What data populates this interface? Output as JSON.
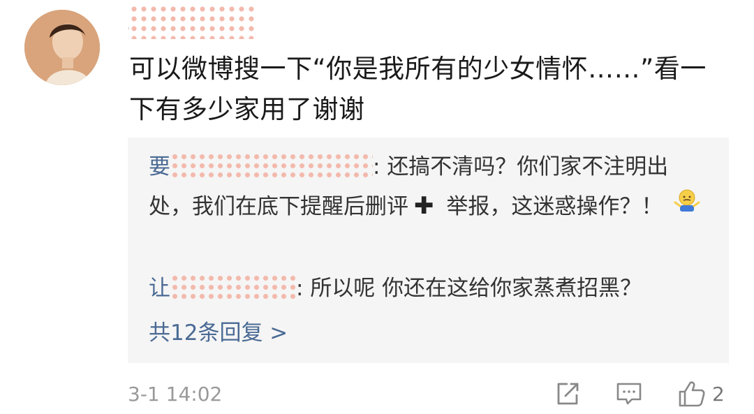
{
  "comment": {
    "username_visible_fragment": "(",
    "text": "可以微博搜一下“你是我所有的少女情怀……”看一下有多少家用了谢谢",
    "timestamp": "3-1 14:02",
    "like_count": "2"
  },
  "replies": [
    {
      "user_prefix": "要",
      "user_suffix": "",
      "separator": ": ",
      "text_part1": "还搞不清吗？你们家不注明出处，我们在底下提醒后删评",
      "text_part2": " 举报，这迷惑操作？！",
      "emoji_name": "shrug-emoji"
    },
    {
      "user_prefix": "让",
      "user_suffix": "",
      "separator": ": ",
      "text": "所以呢 你还在这给你家蒸煮招黑？"
    }
  ],
  "more_replies_label": "共12条回复 >",
  "icons": {
    "share": "share-icon",
    "comment": "comment-icon",
    "like": "like-icon"
  },
  "colors": {
    "link": "#4a6a94",
    "text": "#1a1a1a",
    "muted": "#999999",
    "reply_bg": "#f5f5f5",
    "mosaic": "#f3b9ac"
  }
}
